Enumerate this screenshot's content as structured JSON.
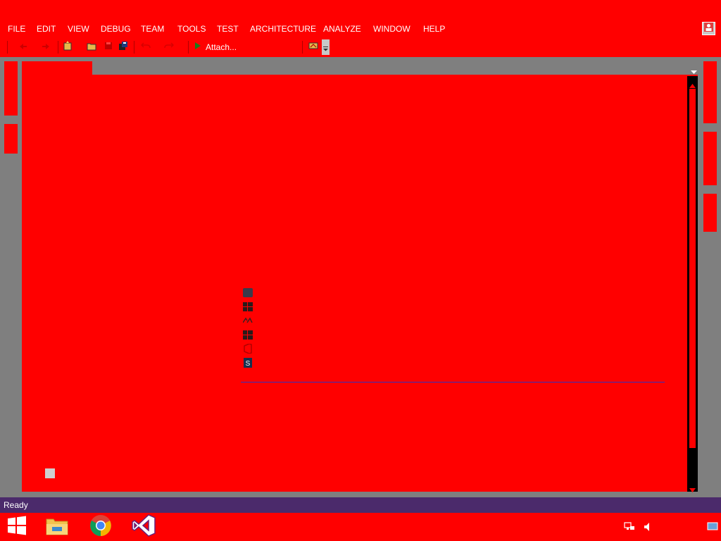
{
  "menu": {
    "items": [
      {
        "label": "FILE",
        "name": "menu-file"
      },
      {
        "label": "EDIT",
        "name": "menu-edit"
      },
      {
        "label": "VIEW",
        "name": "menu-view"
      },
      {
        "label": "DEBUG",
        "name": "menu-debug"
      },
      {
        "label": "TEAM",
        "name": "menu-team"
      },
      {
        "label": "TOOLS",
        "name": "menu-tools"
      },
      {
        "label": "TEST",
        "name": "menu-test"
      },
      {
        "label": "ARCHITECTURE",
        "name": "menu-architecture"
      },
      {
        "label": "ANALYZE",
        "name": "menu-analyze"
      },
      {
        "label": "WINDOW",
        "name": "menu-window"
      },
      {
        "label": "HELP",
        "name": "menu-help"
      }
    ]
  },
  "toolbar": {
    "attach_label": "Attach...",
    "icons": [
      "back-icon",
      "forward-icon",
      "new-project-icon",
      "open-file-icon",
      "save-icon",
      "save-all-icon",
      "undo-icon",
      "redo-icon",
      "start-icon",
      "toolbar-extra-icon"
    ]
  },
  "start_page": {
    "link_icons": [
      "dark-square-icon",
      "windows-icon",
      "azure-icon",
      "windows-icon",
      "office-icon",
      "sharepoint-icon"
    ]
  },
  "status": {
    "text": "Ready"
  },
  "taskbar": {
    "apps": [
      "windows-start-icon",
      "file-explorer-icon",
      "chrome-icon",
      "visual-studio-icon"
    ],
    "tray": [
      "network-icon",
      "volume-icon",
      "show-desktop-icon"
    ]
  },
  "colors": {
    "theme": "#ff0000",
    "statusbar": "#4b2a6b",
    "panel": "#7f7f7f",
    "scrollbar": "#000000"
  }
}
